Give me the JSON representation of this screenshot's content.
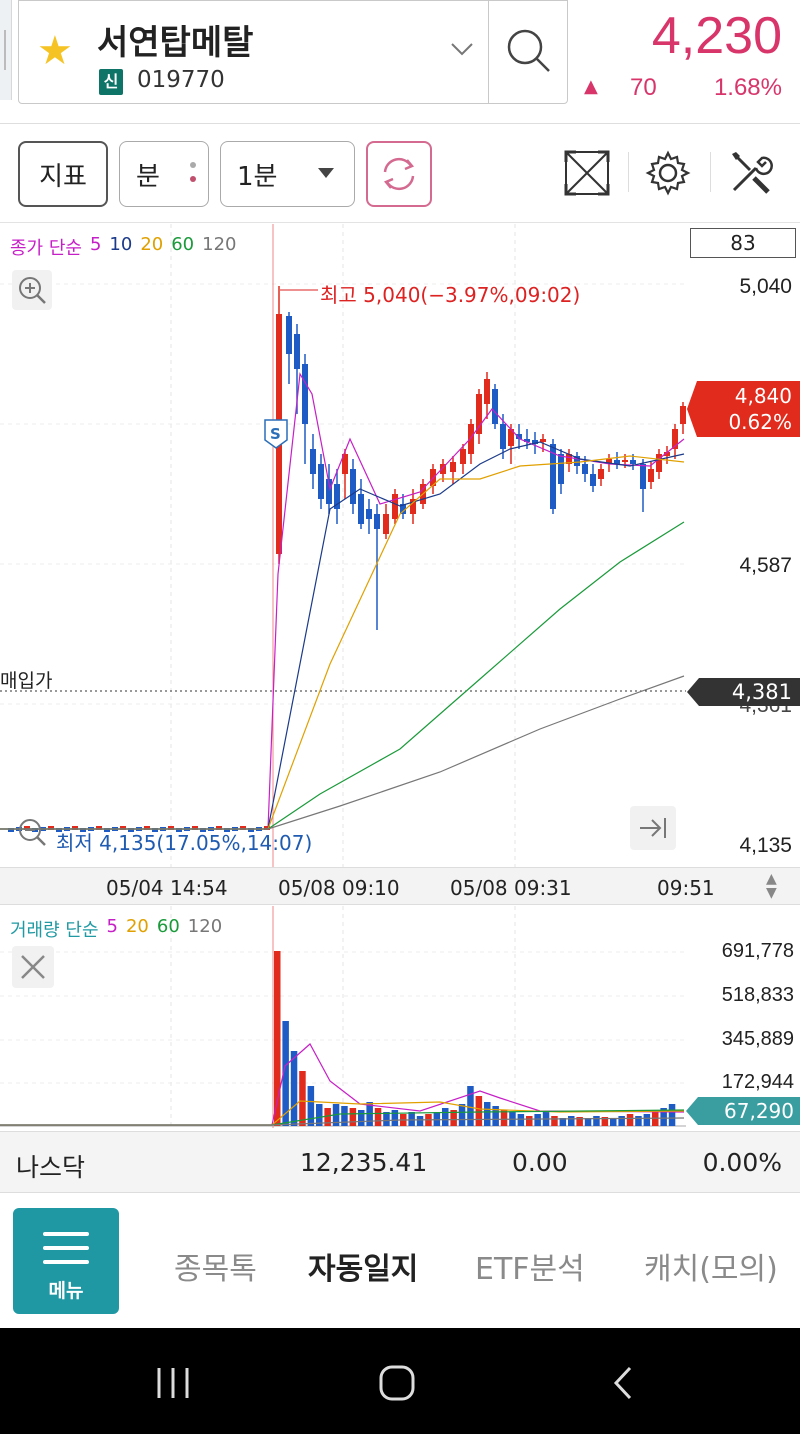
{
  "header": {
    "stock_name": "서연탑메탈",
    "badge": "신",
    "code": "019770",
    "price": "4,230",
    "change_arrow": "▲",
    "change": "70",
    "change_pct": "1.68%"
  },
  "toolbar": {
    "indicator_label": "지표",
    "unit_label": "분",
    "period_label": "1분"
  },
  "price_chart": {
    "legend_prefix": "종가 단순",
    "legend_items": [
      {
        "label": "5",
        "color": "#c71fc7"
      },
      {
        "label": "10",
        "color": "#1b3a8a"
      },
      {
        "label": "20",
        "color": "#e0a000"
      },
      {
        "label": "60",
        "color": "#1a9a3a"
      },
      {
        "label": "120",
        "color": "#777777"
      }
    ],
    "box_value": "83",
    "y_labels": [
      "5,040",
      "4,587",
      "4,361",
      "4,135"
    ],
    "current_tag": {
      "price": "4,840",
      "pct": "0.62%"
    },
    "purchase_label": "매입가",
    "purchase_price": "4,381",
    "high_annotation": "최고 5,040(−3.97%,09:02)",
    "low_annotation": "최저 4,135(17.05%,14:07)",
    "up_color": "#e12b1c",
    "down_color": "#1f5bc4"
  },
  "time_axis": [
    "05/04 14:54",
    "05/08 09:10",
    "05/08 09:31",
    "09:51"
  ],
  "volume_chart": {
    "legend_prefix": "거래량 단순",
    "legend_items": [
      {
        "label": "5",
        "color": "#c71fc7"
      },
      {
        "label": "20",
        "color": "#e0a000"
      },
      {
        "label": "60",
        "color": "#1a9a3a"
      },
      {
        "label": "120",
        "color": "#777777"
      }
    ],
    "y_labels": [
      "691,778",
      "518,833",
      "345,889",
      "172,944"
    ],
    "current_volume": "67,290"
  },
  "index_bar": {
    "name": "나스닥",
    "value": "12,235.41",
    "change": "0.00",
    "pct": "0.00%"
  },
  "bottom_nav": {
    "menu_label": "메뉴",
    "items": [
      "종목톡",
      "자동일지",
      "ETF분석",
      "캐치(모의)"
    ]
  }
}
